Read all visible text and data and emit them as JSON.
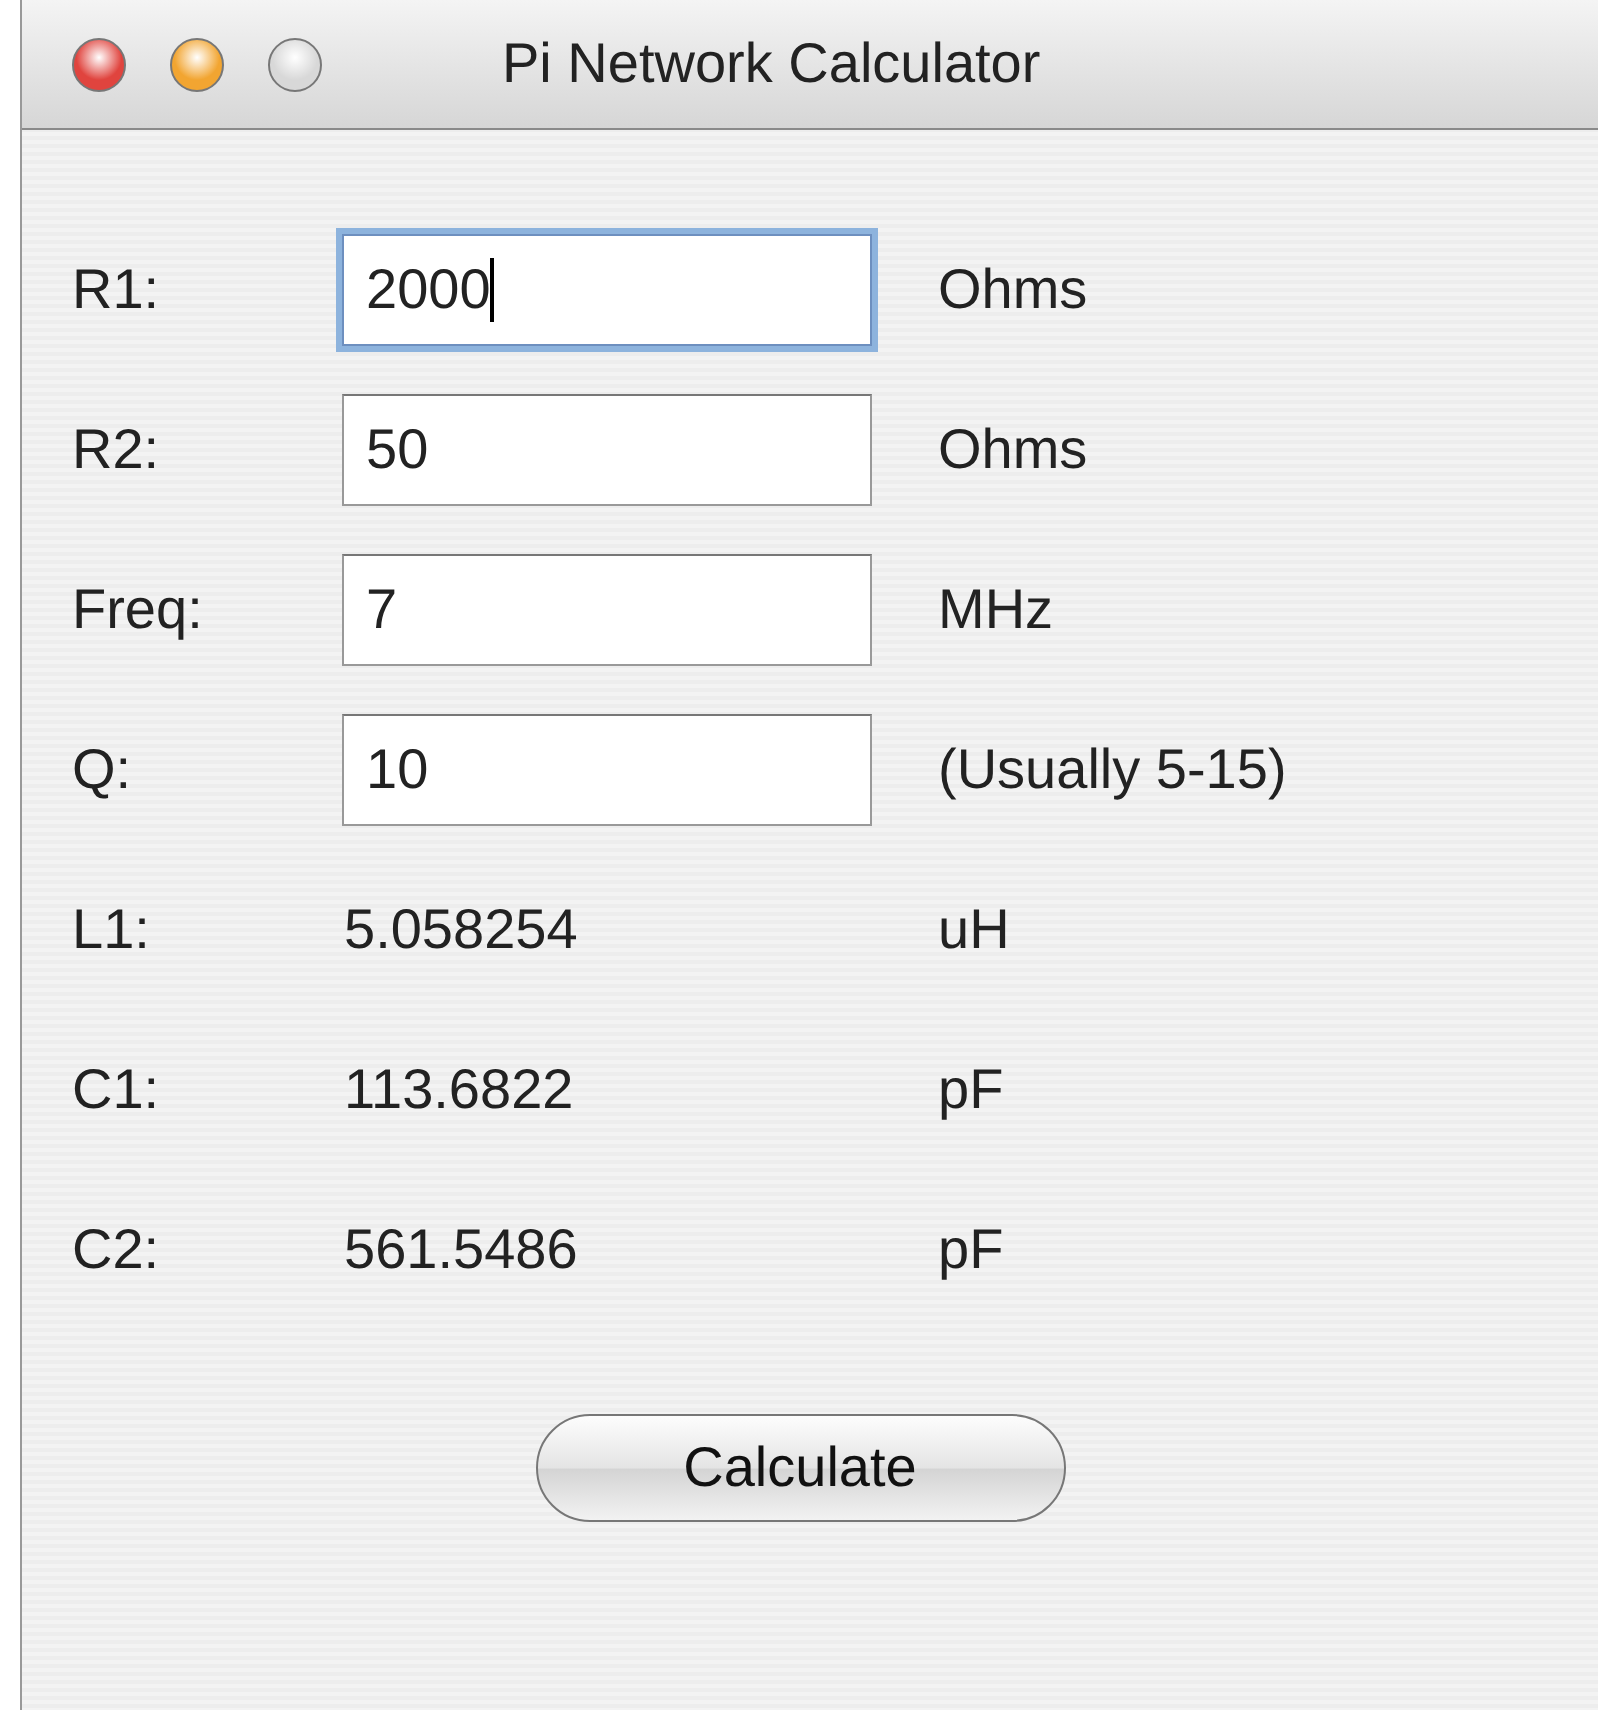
{
  "window": {
    "title": "Pi Network Calculator",
    "buttons": [
      {
        "color": "#e0443e"
      },
      {
        "color": "#f2a531"
      },
      {
        "color": "#d8d8d8"
      }
    ]
  },
  "rows": [
    {
      "kind": "input",
      "label": "R1:",
      "value": "2000",
      "unit": "Ohms",
      "focused": true
    },
    {
      "kind": "input",
      "label": "R2:",
      "value": "50",
      "unit": "Ohms",
      "focused": false
    },
    {
      "kind": "input",
      "label": "Freq:",
      "value": "7",
      "unit": "MHz",
      "focused": false
    },
    {
      "kind": "input",
      "label": "Q:",
      "value": "10",
      "unit": "(Usually 5-15)",
      "focused": false
    },
    {
      "kind": "output",
      "label": "L1:",
      "value": "5.058254",
      "unit": "uH"
    },
    {
      "kind": "output",
      "label": "C1:",
      "value": "113.6822",
      "unit": "pF"
    },
    {
      "kind": "output",
      "label": "C2:",
      "value": "561.5486",
      "unit": "pF"
    }
  ],
  "action": {
    "label": "Calculate"
  }
}
